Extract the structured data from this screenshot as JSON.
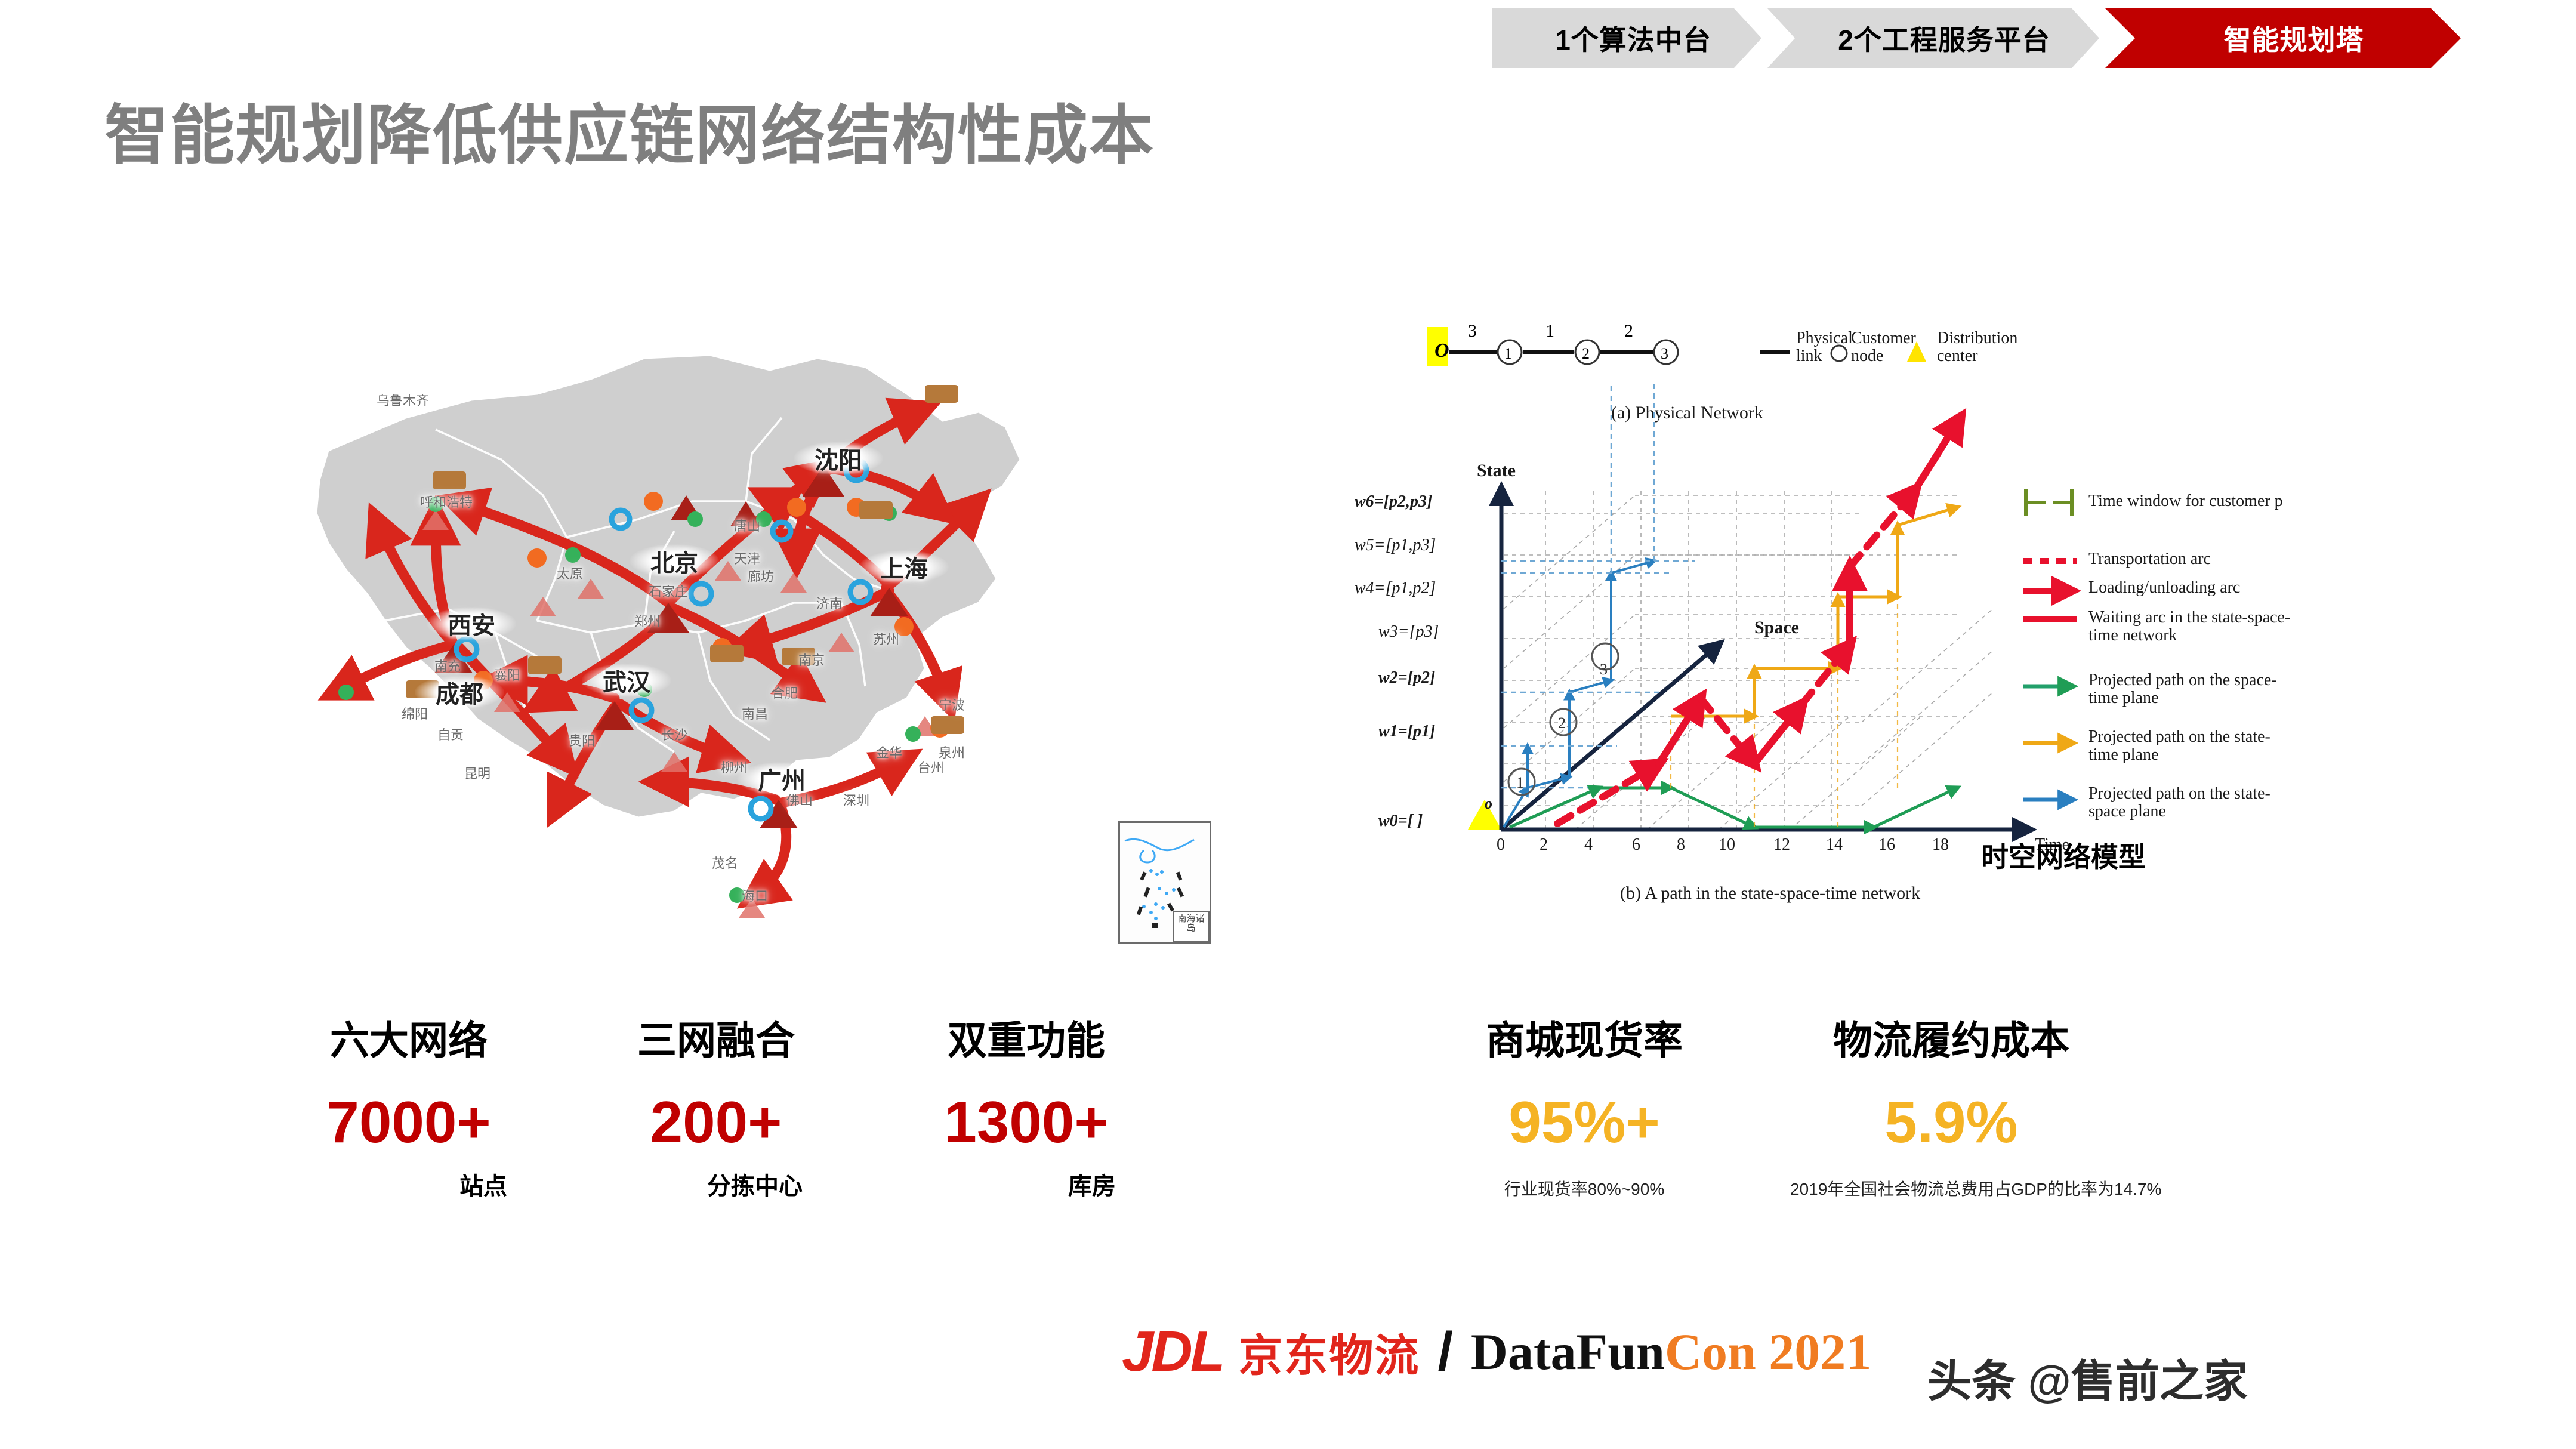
{
  "header": {
    "steps": [
      {
        "label": "1个算法中台",
        "active": false
      },
      {
        "label": "2个工程服务平台",
        "active": false
      },
      {
        "label": "智能规划塔",
        "active": true
      }
    ],
    "accent_color": "#c00000",
    "inactive_color": "#d9d9d9"
  },
  "title": "智能规划降低供应链网络结构性成本",
  "map": {
    "major_cities": [
      "沈阳",
      "北京",
      "西安",
      "成都",
      "武汉",
      "上海",
      "广州"
    ],
    "minor_cities": [
      "乌鲁木齐",
      "呼和浩特",
      "太原",
      "石家庄",
      "廊坊",
      "天津",
      "唐山",
      "济南",
      "郑州",
      "南京",
      "合肥",
      "苏州",
      "宁波",
      "金华",
      "台州",
      "长沙",
      "南昌",
      "柳州",
      "贵阳",
      "昆明",
      "海口",
      "茂名",
      "佛山",
      "深圳",
      "绵阳",
      "南充",
      "自贡",
      "襄阳",
      "泉州"
    ],
    "inset_label": "南海诸岛"
  },
  "stats_left": [
    {
      "title": "六大网络",
      "value": "7000+",
      "unit": "站点",
      "color": "#c00000"
    },
    {
      "title": "三网融合",
      "value": "200+",
      "unit": "分拣中心",
      "color": "#c00000"
    },
    {
      "title": "双重功能",
      "value": "1300+",
      "unit": "库房",
      "color": "#c00000"
    }
  ],
  "stats_right": [
    {
      "title": "商城现货率",
      "value": "95%+",
      "note": "行业现货率80%~90%",
      "color": "#f5b324"
    },
    {
      "title": "物流履约成本",
      "value": "5.9%",
      "note": "2019年全国社会物流总费用占GDP的比率为14.7%",
      "color": "#f5b324"
    }
  ],
  "diagram": {
    "caption_cn": "时空网络模型",
    "physical_network": {
      "caption": "(a) Physical Network",
      "nodes": [
        "O",
        "①",
        "②",
        "③"
      ],
      "edge_labels": [
        "3",
        "1",
        "2"
      ],
      "legend": [
        {
          "symbol": "line",
          "label_line1": "Physical",
          "label_line2": "link"
        },
        {
          "symbol": "circle",
          "label_line1": "Customer",
          "label_line2": "node"
        },
        {
          "symbol": "triangle",
          "label_line1": "Distribution",
          "label_line2": "center"
        }
      ]
    },
    "state_space_time": {
      "caption": "(b) A path in the state-space-time network",
      "axis_state": "State",
      "axis_space": "Space",
      "axis_time": "Time",
      "state_ticks": [
        "w6=[p2,p3]",
        "w5=[p1,p3]",
        "w4=[p1,p2]",
        "w3=[p3]",
        "w2=[p2]",
        "w1=[p1]",
        "w0=[ ]"
      ],
      "time_ticks": [
        "0",
        "2",
        "4",
        "6",
        "8",
        "10",
        "12",
        "14",
        "16",
        "18"
      ],
      "space_nodes": [
        "①",
        "②",
        "③"
      ],
      "origin_label": "o",
      "legend": [
        {
          "key": "time-window",
          "color": "#6b8e23",
          "text": "Time window for customer p"
        },
        {
          "key": "transportation-arc",
          "color": "#e8112d",
          "text": "Transportation arc"
        },
        {
          "key": "loading-unloading-arc",
          "color": "#e8112d",
          "text": "Loading/unloading arc"
        },
        {
          "key": "waiting-arc",
          "color": "#e8112d",
          "text": "Waiting arc in the state-space-time network"
        },
        {
          "key": "projected-space-time",
          "color": "#22a06b",
          "text": "Projected path on the space-time plane"
        },
        {
          "key": "projected-state-time",
          "color": "#f5b324",
          "text": "Projected path on the state-time plane"
        },
        {
          "key": "projected-state-space",
          "color": "#1f77b4",
          "text": "Projected path on the state-space plane"
        }
      ]
    }
  },
  "chart_data": {
    "type": "line",
    "title": "(b) A path in the state-space-time network",
    "xlabel": "Time",
    "ylabel": "State",
    "zlabel": "Space",
    "x": [
      0,
      2,
      4,
      6,
      8,
      10,
      12,
      14,
      16,
      18
    ],
    "state_categories": [
      "w0=[ ]",
      "w1=[p1]",
      "w2=[p2]",
      "w3=[p3]",
      "w4=[p1,p2]",
      "w5=[p1,p3]",
      "w6=[p2,p3]"
    ],
    "space_categories": [
      "o",
      "①",
      "②",
      "③"
    ],
    "series": [
      {
        "name": "Projected path on the state-space plane",
        "color": "#1f77b4",
        "points": [
          [
            0,
            "w0"
          ],
          [
            3,
            "w1"
          ],
          [
            5,
            "w2"
          ],
          [
            9,
            "w2"
          ],
          [
            9,
            "w4"
          ],
          [
            12,
            "w4"
          ],
          [
            12,
            "w5"
          ]
        ]
      },
      {
        "name": "Projected path on the space-time plane",
        "color": "#22a06b",
        "points": [
          [
            0,
            "o"
          ],
          [
            4,
            "①"
          ],
          [
            7,
            "②"
          ],
          [
            11,
            "②"
          ],
          [
            14,
            "③"
          ],
          [
            18,
            "③"
          ]
        ]
      },
      {
        "name": "Projected path on the state-time plane",
        "color": "#f5b324",
        "points": [
          [
            0,
            0
          ],
          [
            4,
            1
          ],
          [
            6,
            1
          ],
          [
            8,
            2
          ],
          [
            10,
            2
          ],
          [
            13,
            3
          ],
          [
            14,
            5
          ],
          [
            18,
            6
          ]
        ]
      },
      {
        "name": "Path in the state-space-time network",
        "color": "#e8112d",
        "points": [
          [
            2,
            0
          ],
          [
            5,
            1
          ],
          [
            7,
            2
          ],
          [
            9,
            1
          ],
          [
            11,
            2
          ],
          [
            13,
            3
          ],
          [
            15,
            5
          ],
          [
            17,
            6
          ]
        ]
      }
    ],
    "grid": true,
    "legend_position": "right"
  },
  "footer": {
    "logo_abbr": "JDL",
    "logo_cn": "京东物流",
    "separator": "/",
    "event_part1": "DataFun",
    "event_part2": "Con 2021",
    "watermark": "头条 @售前之家",
    "jdl_color": "#e1251b",
    "event_accent": "#f07c22"
  }
}
